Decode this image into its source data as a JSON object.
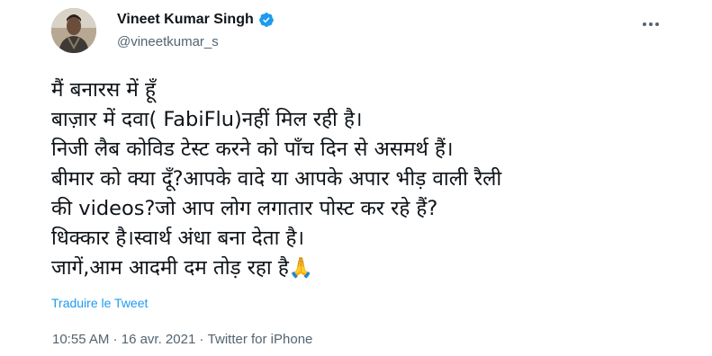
{
  "author": {
    "display_name": "Vineet Kumar Singh",
    "handle": "@vineetkumar_s",
    "verified": true
  },
  "tweet": {
    "lines": [
      "मैं बनारस में हूँ",
      "बाज़ार में दवा( FabiFlu)नहीं मिल रही है।",
      "निजी लैब कोविड टेस्ट करने को पाँच दिन से असमर्थ हैं।",
      "बीमार को क्या दूँ?आपके वादे या आपके अपार भीड़ वाली रैली",
      "की videos?जो आप लोग लगातार पोस्ट कर रहे हैं?",
      "धिक्कार है।स्वार्थ अंधा बना देता है।",
      "जागें,आम आदमी दम तोड़ रहा है"
    ],
    "emoji": "🙏",
    "translate_label": "Traduire le Tweet"
  },
  "meta": {
    "time": "10:55 AM",
    "separator1": " · ",
    "date": "16 avr. 2021",
    "separator2": " · ",
    "source": "Twitter for iPhone"
  },
  "icons": {
    "verified": "verified-badge-icon",
    "more": "more-horizontal-icon"
  },
  "colors": {
    "accent": "#1d9bf0",
    "secondary_text": "#536471",
    "primary_text": "#0f1419"
  }
}
